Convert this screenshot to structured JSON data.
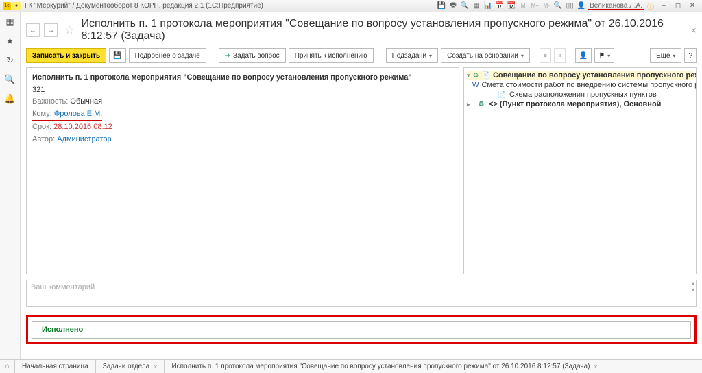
{
  "titlebar": {
    "app_title": "ГК \"Меркурий\" / Документооборот 8 КОРП, редакция 2.1  (1С:Предприятие)",
    "user": "Великанова Л.А."
  },
  "header": {
    "title": "Исполнить п. 1 протокола мероприятия \"Совещание по вопросу установления пропускного режима\" от 26.10.2016 8:12:57 (Задача)"
  },
  "toolbar": {
    "save_close": "Записать и закрыть",
    "about_task": "Подробнее о задаче",
    "ask_question": "Задать вопрос",
    "accept_exec": "Принять к исполнению",
    "subtasks": "Подзадачи",
    "create_based": "Создать на основании",
    "more": "Еще"
  },
  "task": {
    "title": "Исполнить п. 1 протокола мероприятия \"Совещание по вопросу установления пропускного режима\"",
    "number": "321",
    "importance_label": "Важность:",
    "importance_value": "Обычная",
    "to_label": "Кому:",
    "to_value": "Фролова Е.М.",
    "due_label": "Срок:",
    "due_value": "28.10.2016 08:12",
    "author_label": "Автор:",
    "author_value": "Администратор"
  },
  "tree": {
    "root": "Совещание по вопросу установления пропускного режима (Мероп",
    "item1": "Смета стоимости работ по внедрению системы пропускного режима",
    "item2": "Схема расположения пропускных пунктов",
    "item3": "<> (Пункт протокола мероприятия), Основной"
  },
  "comment": {
    "placeholder": "Ваш комментарий"
  },
  "done": {
    "label": "Исполнено"
  },
  "tabs": {
    "t1": "Начальная страница",
    "t2": "Задачи отдела",
    "t3": "Исполнить п. 1 протокола мероприятия \"Совещание по вопросу установления пропускного режима\" от 26.10.2016 8:12:57 (Задача)"
  }
}
